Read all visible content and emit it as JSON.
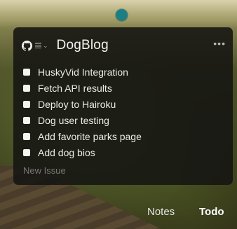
{
  "app": {
    "title": "DogBlog"
  },
  "header": {
    "icons": [
      "github-icon",
      "list-menu-icon",
      "chevron-down-icon",
      "more-icon"
    ],
    "more_label": "•••"
  },
  "todos": [
    {
      "label": "HuskyVid Integration",
      "checked": false
    },
    {
      "label": "Fetch API results",
      "checked": false
    },
    {
      "label": "Deploy to Hairoku",
      "checked": false
    },
    {
      "label": "Dog user testing",
      "checked": false
    },
    {
      "label": "Add favorite parks page",
      "checked": false
    },
    {
      "label": "Add dog bios",
      "checked": false
    }
  ],
  "new_issue": {
    "placeholder": "New Issue"
  },
  "tabs": [
    {
      "label": "Notes",
      "active": false
    },
    {
      "label": "Todo",
      "active": true
    }
  ],
  "colors": {
    "accent_dot": "#1b7f86",
    "panel_bg": "#141412"
  }
}
